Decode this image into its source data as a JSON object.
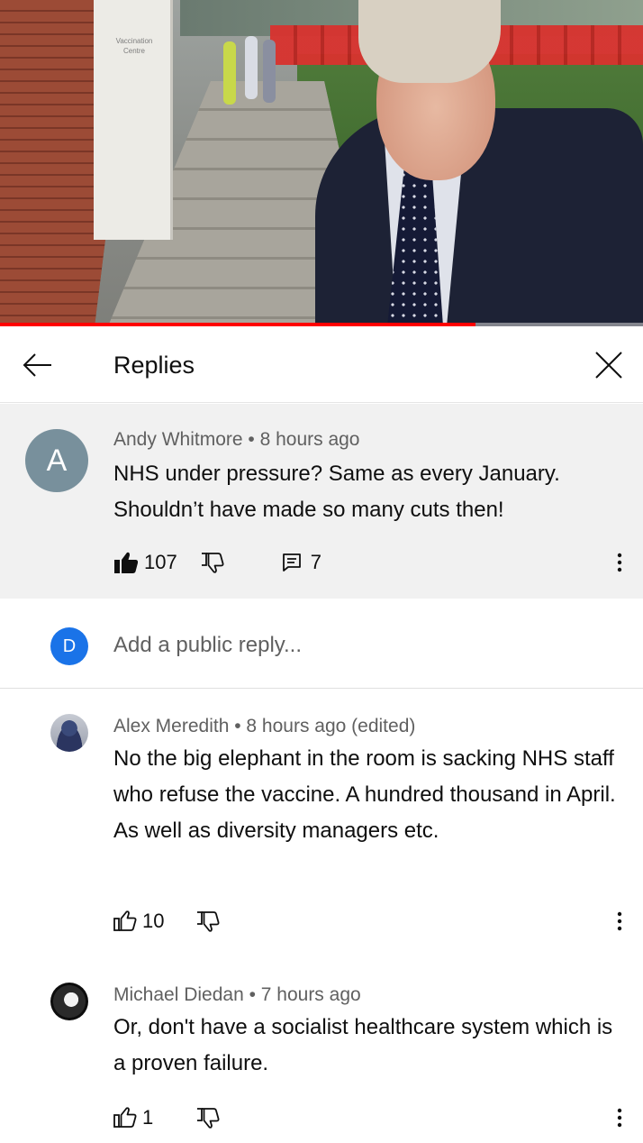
{
  "video": {
    "sign_text": "Vaccination Centre",
    "progress_percent": 74,
    "progress_color": "#ff0000"
  },
  "header": {
    "back_icon": "arrow-left-icon",
    "title": "Replies",
    "close_icon": "close-icon"
  },
  "top_comment": {
    "avatar_letter": "A",
    "avatar_color": "#78909c",
    "meta": "Andy Whitmore • 8 hours ago",
    "text": "NHS under pressure? Same as every January. Shouldn’t have made so many cuts then!",
    "likes": "107",
    "replies_count": "7",
    "liked": true
  },
  "reply_box": {
    "avatar_letter": "D",
    "avatar_color": "#1a73e8",
    "placeholder": "Add a public reply..."
  },
  "replies": [
    {
      "meta": "Alex Meredith • 8 hours ago (edited)",
      "text": "No the big elephant in the room is sacking NHS staff who refuse the vaccine. A hundred thousand in April. As well as diversity managers etc.",
      "likes": "10"
    },
    {
      "meta": "Michael Diedan • 7 hours ago",
      "text": "Or, don't have a socialist healthcare system which is a proven failure.",
      "likes": "1"
    }
  ]
}
